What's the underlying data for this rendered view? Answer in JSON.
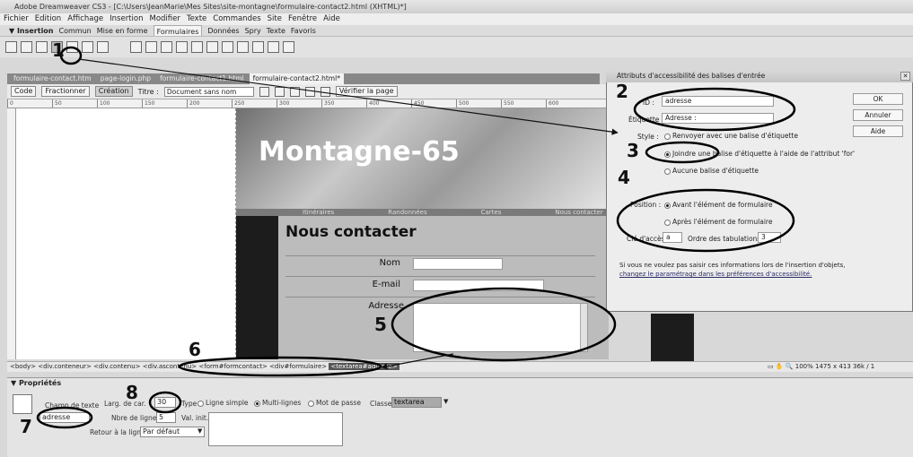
{
  "window": {
    "title": "Adobe Dreamweaver CS3 - [C:\\Users\\JeanMarie\\Mes Sites\\site-montagne\\formulaire-contact2.html (XHTML)*]"
  },
  "menu": [
    "Fichier",
    "Edition",
    "Affichage",
    "Insertion",
    "Modifier",
    "Texte",
    "Commandes",
    "Site",
    "Fenêtre",
    "Aide"
  ],
  "insert_panel": {
    "label": "▼ Insertion",
    "tabs": [
      "Commun",
      "Mise en forme",
      "Formulaires",
      "Données",
      "Spry",
      "Texte",
      "Favoris"
    ],
    "active": "Formulaires"
  },
  "doc_tabs": [
    "formulaire-contact.htm",
    "page-login.php",
    "formulaire-contact1.html",
    "formulaire-contact2.html*"
  ],
  "doc_toolbar": {
    "code": "Code",
    "split": "Fractionner",
    "design": "Création",
    "title_label": "Titre :",
    "title_value": "Document sans nom",
    "validate": "Vérifier la page"
  },
  "ruler_ticks": [
    "0",
    "50",
    "100",
    "150",
    "200",
    "250",
    "300",
    "350",
    "400",
    "450",
    "500",
    "550",
    "600"
  ],
  "page": {
    "banner_title": "Montagne-65",
    "nav": [
      "Itinéraires",
      "Randonnées",
      "Cartes",
      "Nous contacter"
    ],
    "heading": "Nous contacter",
    "labels": {
      "name": "Nom",
      "email": "E-mail",
      "address": "Adresse"
    }
  },
  "tag_selector": {
    "path": "<body> <div.conteneur> <div.contenu> <div.ascontenu>",
    "form": "<form#formcontact>",
    "div": "<div#formulaire>",
    "selected": "<textarea#adresse>"
  },
  "status": {
    "zoom": "100%",
    "size": "1475 x 413",
    "weight": "36k / 1"
  },
  "properties": {
    "header": "▼ Propriétés",
    "element_label": "Champ de texte",
    "name_value": "adresse",
    "char_width_label": "Larg. de car.",
    "char_width_value": "30",
    "type_label": "Type",
    "type_options": [
      "Ligne simple",
      "Multi-lignes",
      "Mot de passe"
    ],
    "type_selected": "Multi-lignes",
    "lines_label": "Nbre de lignes",
    "lines_value": "5",
    "init_label": "Val. init.",
    "wrap_label": "Retour à la ligne",
    "wrap_value": "Par défaut",
    "class_label": "Classe",
    "class_value": "textarea"
  },
  "dialog": {
    "title": "Attributs d'accessibilité des balises d'entrée",
    "id_label": "ID :",
    "id_value": "adresse",
    "label_label": "Étiquette :",
    "label_value": "Adresse :",
    "style_label": "Style :",
    "style_options": [
      "Renvoyer avec une balise d'étiquette",
      "Joindre une balise d'étiquette à l'aide de l'attribut 'for'",
      "Aucune balise d'étiquette"
    ],
    "style_selected": 1,
    "position_label": "Position :",
    "position_options": [
      "Avant l'élément de formulaire",
      "Après l'élément de formulaire"
    ],
    "position_selected": 0,
    "access_label": "Clé d'accès :",
    "access_value": "a",
    "tab_label": "Ordre des tabulations :",
    "tab_value": "3",
    "info_text": "Si vous ne voulez pas saisir ces informations lors de l'insertion d'objets,",
    "info_link": "changez le paramétrage dans les préférences d'accessibilité.",
    "buttons": [
      "OK",
      "Annuler",
      "Aide"
    ]
  },
  "callouts": [
    "1",
    "2",
    "3",
    "4",
    "5",
    "6",
    "7",
    "8"
  ]
}
